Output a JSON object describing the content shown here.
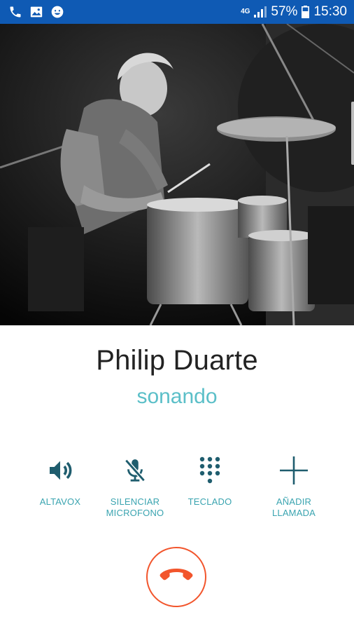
{
  "status_bar": {
    "icons": [
      "phone-icon",
      "image-icon",
      "smiley-icon"
    ],
    "network": "4G",
    "battery": "57%",
    "time": "15:30",
    "background": "#0f5ab4"
  },
  "contact": {
    "photo_description_icon": "contact-photo",
    "name": "Philip Duarte",
    "status": "sonando"
  },
  "actions": [
    {
      "icon": "speaker-icon",
      "label": "ALTAVOX"
    },
    {
      "icon": "mic-off-icon",
      "label": "SILENCIAR\nMICROFONO"
    },
    {
      "icon": "dialpad-icon",
      "label": "TECLADO"
    },
    {
      "icon": "add-icon",
      "label": "AÑADIR\nLLAMADA"
    }
  ],
  "hangup": {
    "icon": "end-call-icon",
    "color": "#f2552c"
  },
  "colors": {
    "accent": "#3aa4b0",
    "status_text": "#5bbfc8",
    "icon": "#1f5d6e"
  }
}
